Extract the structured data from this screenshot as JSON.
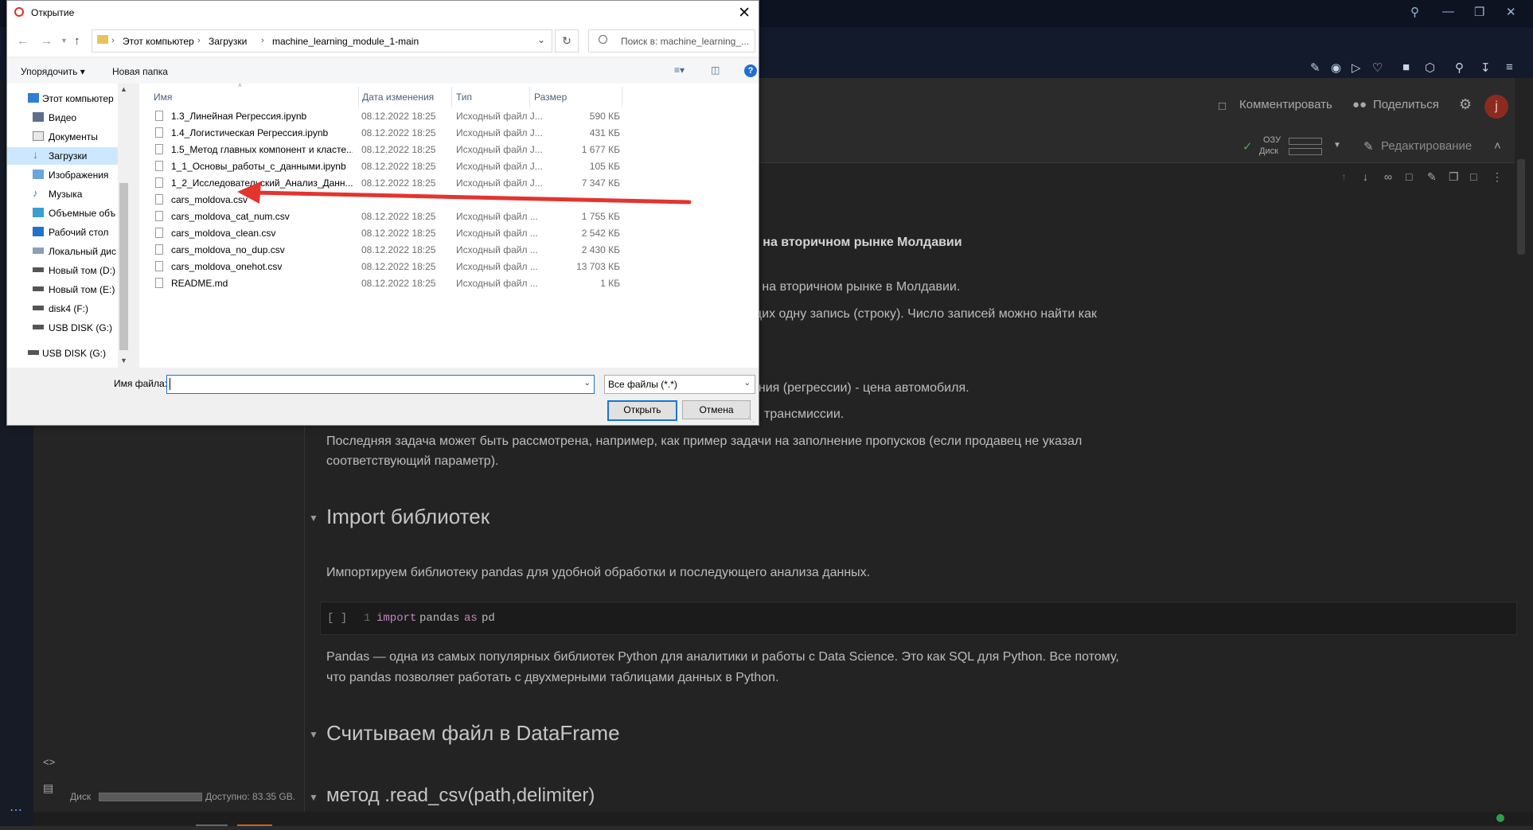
{
  "browser": {
    "colors": {
      "topbar": "#0d1320",
      "toolbar": "#121a2b"
    }
  },
  "colab": {
    "header": {
      "comment_label": "Комментировать",
      "share_label": "Поделиться",
      "avatar_letter": "j"
    },
    "status": {
      "ram_label": "ОЗУ",
      "disk_label": "Диск",
      "editing_label": "Редактирование"
    },
    "sidebar": {
      "disk_label": "Диск",
      "disk_available": "Доступно: 83.35 GB."
    },
    "notebook": {
      "title_fragment": "й на вторичном рынке Молдавии",
      "para1": "й на вторичном рынке в Молдавии.",
      "para2": "щих одну запись (строку). Число записей можно найти как",
      "para3": "ания (регрессии) - цена автомобиля.",
      "para4": "трансмиссии.",
      "para5_line1": "Последняя задача может быть рассмотрена, например, как пример задачи на заполнение пропусков (если продавец не указал",
      "para5_line2": "соответствующий параметр).",
      "section_import": "Import библиотек",
      "import_text": "Импортируем библиотеку pandas для удобной обработки и последующего анализа данных.",
      "code_bracket": "[ ]",
      "code_line_no": "1",
      "code_kw_import": "import",
      "code_module": "pandas",
      "code_kw_as": "as",
      "code_alias": "pd",
      "pandas_line1": "Pandas — одна из самых популярных библиотек Python для аналитики и работы с Data Science. Это как SQL для Python. Все потому,",
      "pandas_line2": "что pandas позволяет работать с двухмерными таблицами данных в Python.",
      "section_read": "Считываем файл в DataFrame",
      "section_method": "метод .read_csv(path,delimiter)"
    }
  },
  "dialog": {
    "title": "Открытие",
    "breadcrumb": [
      "Этот компьютер",
      "Загрузки",
      "machine_learning_module_1-main"
    ],
    "search_placeholder": "Поиск в: machine_learning_...",
    "toolbar": {
      "organize": "Упорядочить ▾",
      "new_folder": "Новая папка"
    },
    "nav_items": [
      {
        "label": "Этот компьютер",
        "icon": "computer-icon"
      },
      {
        "label": "Видео",
        "icon": "video-icon"
      },
      {
        "label": "Документы",
        "icon": "documents-icon"
      },
      {
        "label": "Загрузки",
        "icon": "downloads-icon",
        "selected": true
      },
      {
        "label": "Изображения",
        "icon": "images-icon"
      },
      {
        "label": "Музыка",
        "icon": "music-icon"
      },
      {
        "label": "Объемные объ",
        "icon": "3d-objects-icon"
      },
      {
        "label": "Рабочий стол",
        "icon": "desktop-icon"
      },
      {
        "label": "Локальный дис",
        "icon": "local-disk-icon"
      },
      {
        "label": "Новый том (D:)",
        "icon": "drive-icon"
      },
      {
        "label": "Новый том (E:)",
        "icon": "drive-icon"
      },
      {
        "label": "disk4 (F:)",
        "icon": "drive-icon"
      },
      {
        "label": "USB DISK (G:)",
        "icon": "usb-drive-icon"
      },
      {
        "label": "USB DISK (G:)",
        "icon": "usb-drive-icon"
      }
    ],
    "columns": {
      "name": "Имя",
      "date": "Дата изменения",
      "type": "Тип",
      "size": "Размер"
    },
    "files": [
      {
        "name": "1.3_Линейная Регрессия.ipynb",
        "date": "08.12.2022 18:25",
        "type": "Исходный файл J...",
        "size": "590 КБ"
      },
      {
        "name": "1.4_Логистическая Регрессия.ipynb",
        "date": "08.12.2022 18:25",
        "type": "Исходный файл J...",
        "size": "431 КБ"
      },
      {
        "name": "1.5_Метод главных компонент и класте...",
        "date": "08.12.2022 18:25",
        "type": "Исходный файл J...",
        "size": "1 677 КБ"
      },
      {
        "name": "1_1_Основы_работы_с_данными.ipynb",
        "date": "08.12.2022 18:25",
        "type": "Исходный файл J...",
        "size": "105 КБ"
      },
      {
        "name": "1_2_Исследовательский_Анализ_Данн...",
        "date": "08.12.2022 18:25",
        "type": "Исходный файл J...",
        "size": "7 347 КБ"
      },
      {
        "name": "cars_moldova.csv",
        "date": "",
        "type": "",
        "size": ""
      },
      {
        "name": "cars_moldova_cat_num.csv",
        "date": "08.12.2022 18:25",
        "type": "Исходный файл ...",
        "size": "1 755 КБ"
      },
      {
        "name": "cars_moldova_clean.csv",
        "date": "08.12.2022 18:25",
        "type": "Исходный файл ...",
        "size": "2 542 КБ"
      },
      {
        "name": "cars_moldova_no_dup.csv",
        "date": "08.12.2022 18:25",
        "type": "Исходный файл ...",
        "size": "2 430 КБ"
      },
      {
        "name": "cars_moldova_onehot.csv",
        "date": "08.12.2022 18:25",
        "type": "Исходный файл ...",
        "size": "13 703 КБ"
      },
      {
        "name": "README.md",
        "date": "08.12.2022 18:25",
        "type": "Исходный файл ...",
        "size": "1 КБ"
      }
    ],
    "filename_label": "Имя файла:",
    "filename_value": "",
    "filetype_value": "Все файлы (*.*)",
    "open_label": "Открыть",
    "cancel_label": "Отмена",
    "colors": {
      "accent": "#1c74d0",
      "selection": "#cce8ff",
      "annotation_arrow": "#e3342f"
    }
  }
}
